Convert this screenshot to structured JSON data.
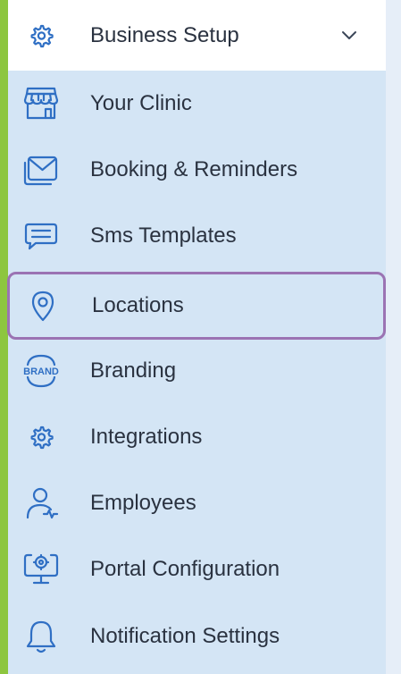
{
  "header": {
    "label": "Business Setup",
    "icon": "gear-icon",
    "expanded": true
  },
  "items": [
    {
      "label": "Your Clinic",
      "icon": "storefront-icon"
    },
    {
      "label": "Booking & Reminders",
      "icon": "envelope-icon"
    },
    {
      "label": "Sms Templates",
      "icon": "message-icon"
    },
    {
      "label": "Locations",
      "icon": "location-pin-icon",
      "selected": true
    },
    {
      "label": "Branding",
      "icon": "brand-badge-icon",
      "badge_text": "BRAND"
    },
    {
      "label": "Integrations",
      "icon": "gear-icon"
    },
    {
      "label": "Employees",
      "icon": "user-icon"
    },
    {
      "label": "Portal Configuration",
      "icon": "monitor-gear-icon"
    },
    {
      "label": "Notification Settings",
      "icon": "bell-icon"
    }
  ],
  "colors": {
    "accent": "#2f6fc4",
    "menu_background": "#d4e5f5",
    "selected_border": "#9b73b3",
    "side_bar": "#8dc63f",
    "text": "#2a3240"
  }
}
